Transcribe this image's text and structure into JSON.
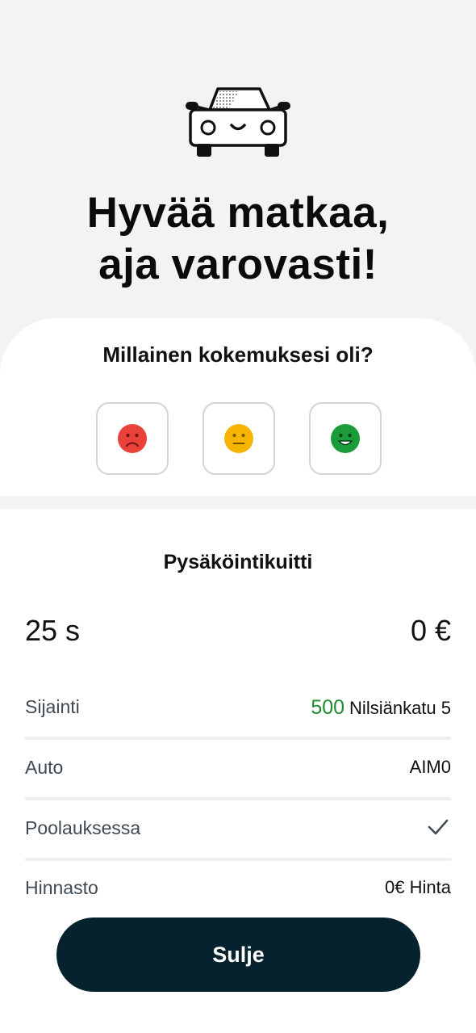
{
  "header": {
    "title_line1": "Hyvää matkaa,",
    "title_line2": "aja varovasti!",
    "illustration": "car-icon"
  },
  "rating": {
    "question": "Millainen kokemuksesi oli?",
    "options": [
      {
        "mood": "sad",
        "icon": "sad-face-icon",
        "color": "#e8423a"
      },
      {
        "mood": "neutral",
        "icon": "neutral-face-icon",
        "color": "#f4b400"
      },
      {
        "mood": "happy",
        "icon": "happy-face-icon",
        "color": "#1a9c3a"
      }
    ]
  },
  "receipt": {
    "title": "Pysäköintikuitti",
    "duration": "25 s",
    "price": "0 €",
    "rows": [
      {
        "label": "Sijainti",
        "zone": "500",
        "value": "Nilsiänkatu 5"
      },
      {
        "label": "Auto",
        "value": "AIM0"
      },
      {
        "label": "Poolauksessa",
        "value_icon": "checkmark-icon"
      },
      {
        "label": "Hinnasto",
        "value": "0€ Hinta"
      }
    ]
  },
  "actions": {
    "close_label": "Sulje"
  },
  "colors": {
    "background": "#f2f3f5",
    "zone_green": "#1f8a2e",
    "button_dark": "#06222f"
  }
}
